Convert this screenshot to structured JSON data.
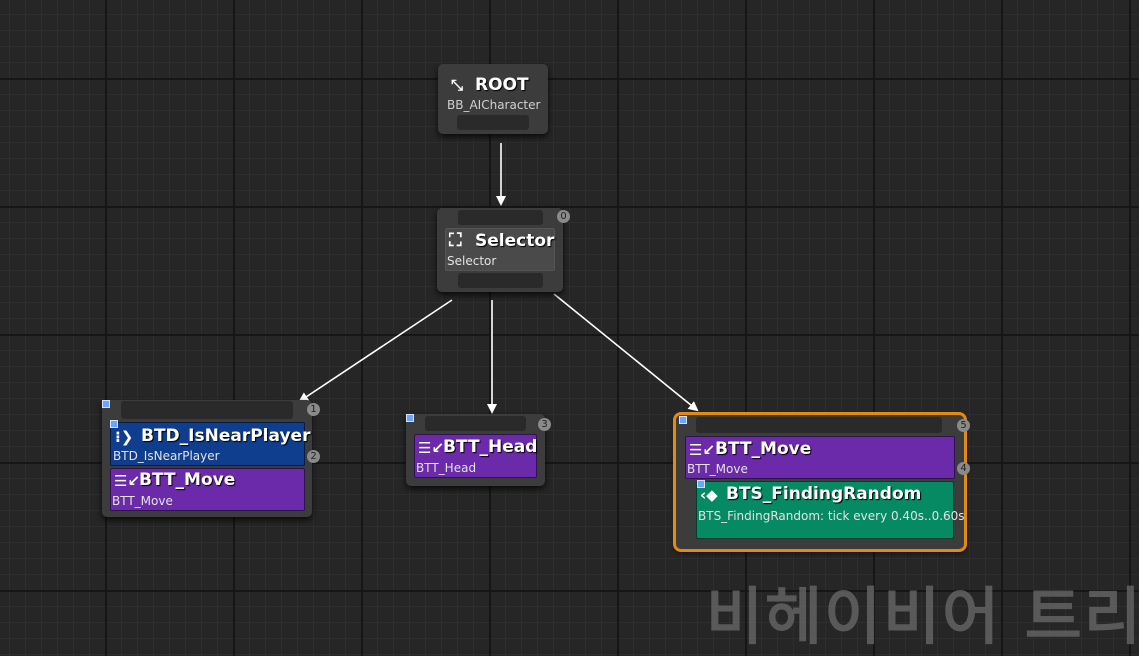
{
  "graph": {
    "root": {
      "title": "ROOT",
      "subtitle": "BB_AICharacter"
    },
    "selector": {
      "title": "Selector",
      "subtitle": "Selector",
      "index": "0"
    },
    "near_player": {
      "decorator_title": "BTD_IsNearPlayer",
      "decorator_subtitle": "BTD_IsNearPlayer",
      "decorator_index": "1",
      "task_title": "BTT_Move",
      "task_subtitle": "BTT_Move",
      "task_index": "2"
    },
    "head": {
      "title": "BTT_Head",
      "subtitle": "BTT_Head",
      "index": "3"
    },
    "move": {
      "title": "BTT_Move",
      "subtitle": "BTT_Move",
      "index": "5",
      "service_title": "BTS_FindingRandom",
      "service_subtitle": "BTS_FindingRandom: tick every 0.40s..0.60s",
      "service_index": "4"
    }
  },
  "watermark": "비헤이비어 트리",
  "colors": {
    "task": "#6b2aaa",
    "decorator": "#103e8e",
    "service": "#068a64",
    "selection": "#e38a12"
  }
}
